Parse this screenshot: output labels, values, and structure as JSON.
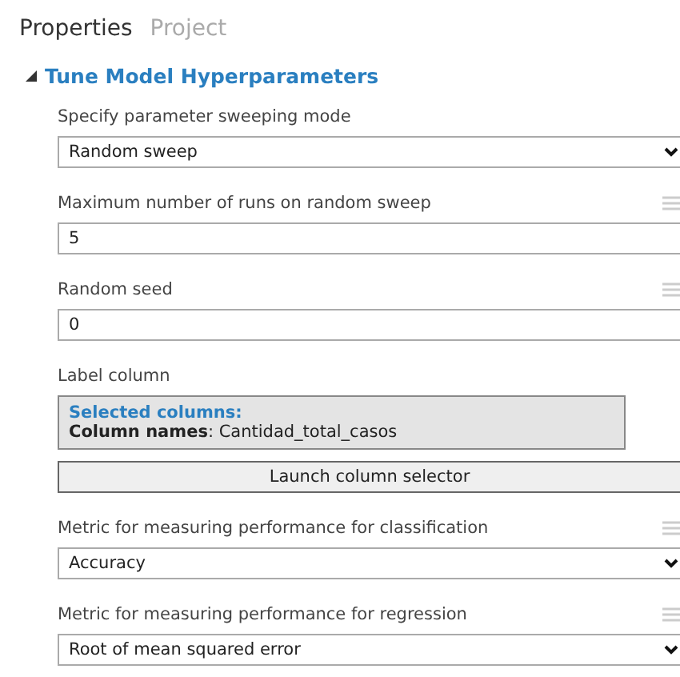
{
  "tabs": [
    {
      "label": "Properties",
      "selected": true
    },
    {
      "label": "Project",
      "selected": false
    }
  ],
  "section": {
    "title": "Tune Model Hyperparameters",
    "expanded": true
  },
  "parameters": [
    {
      "kind": "dropdown",
      "label": "Specify parameter sweeping mode",
      "value": "Random sweep",
      "handle": false
    },
    {
      "kind": "text",
      "label": "Maximum number of runs on random sweep",
      "value": "5",
      "handle": true
    },
    {
      "kind": "text",
      "label": "Random seed",
      "value": "0",
      "handle": true
    },
    {
      "kind": "column-selector",
      "label": "Label column",
      "selected_title": "Selected columns:",
      "names_label": "Column names",
      "names_value": ": Cantidad_total_casos",
      "button": "Launch column selector",
      "handle": false
    },
    {
      "kind": "dropdown",
      "label": "Metric for measuring performance for classification",
      "value": "Accuracy",
      "handle": true
    },
    {
      "kind": "dropdown",
      "label": "Metric for measuring performance for regression",
      "value": "Root of mean squared error",
      "handle": true
    }
  ]
}
